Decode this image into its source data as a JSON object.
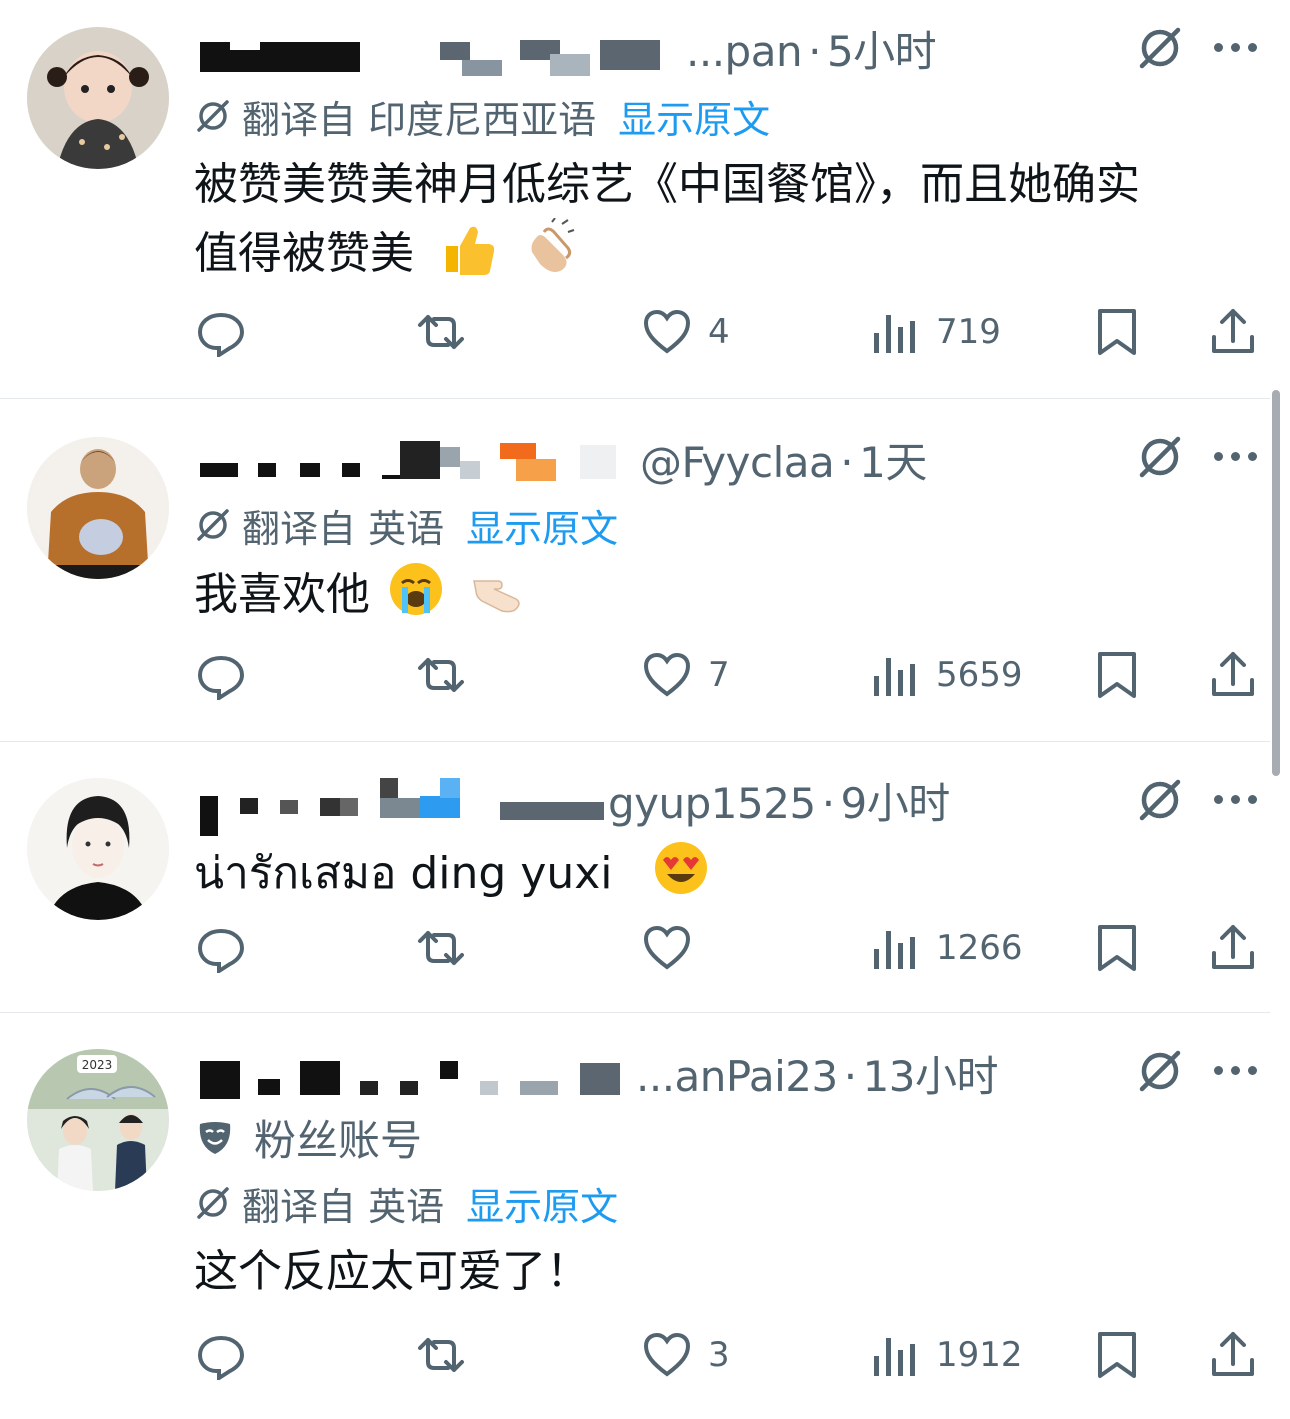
{
  "posts": [
    {
      "handle_tail": "...pan",
      "time": "5小时",
      "translate": {
        "label": "翻译自 印度尼西亚语",
        "show": "显示原文"
      },
      "fan_label": "",
      "text_lines": [
        "被赞美赞美神月低综艺《中国餐馆》，而且她确实",
        "值得被赞美"
      ],
      "emojis": [
        "thumbs-up-emoji",
        "clapping-hands-emoji"
      ],
      "likes": "4",
      "views": "719"
    },
    {
      "handle_tail": "@Fyyclaa",
      "time": "1天",
      "translate": {
        "label": "翻译自 英语",
        "show": "显示原文"
      },
      "fan_label": "",
      "text_lines": [
        "我喜欢他"
      ],
      "emojis": [
        "crying-face-emoji",
        "pointing-hand-emoji"
      ],
      "likes": "7",
      "views": "5659"
    },
    {
      "handle_tail": "gyup1525",
      "time": "9小时",
      "translate": {
        "label": "",
        "show": ""
      },
      "fan_label": "",
      "text_lines": [
        "น่ารักเสมอ  ding yuxi"
      ],
      "emojis": [
        "heart-eyes-emoji"
      ],
      "likes": "",
      "views": "1266"
    },
    {
      "handle_tail": "...anPai23",
      "time": "13小时",
      "translate": {
        "label": "翻译自 英语",
        "show": "显示原文"
      },
      "fan_label": "粉丝账号",
      "text_lines": [
        "这个反应太可爱了！"
      ],
      "emojis": [],
      "likes": "3",
      "views": "1912"
    }
  ],
  "avatar_badges": {
    "post4": "2023"
  },
  "dot_separator": "·",
  "colors": {
    "text": "#0f1419",
    "secondary": "#536471",
    "link": "#1d9bf0",
    "divider": "#e6e9ec"
  }
}
